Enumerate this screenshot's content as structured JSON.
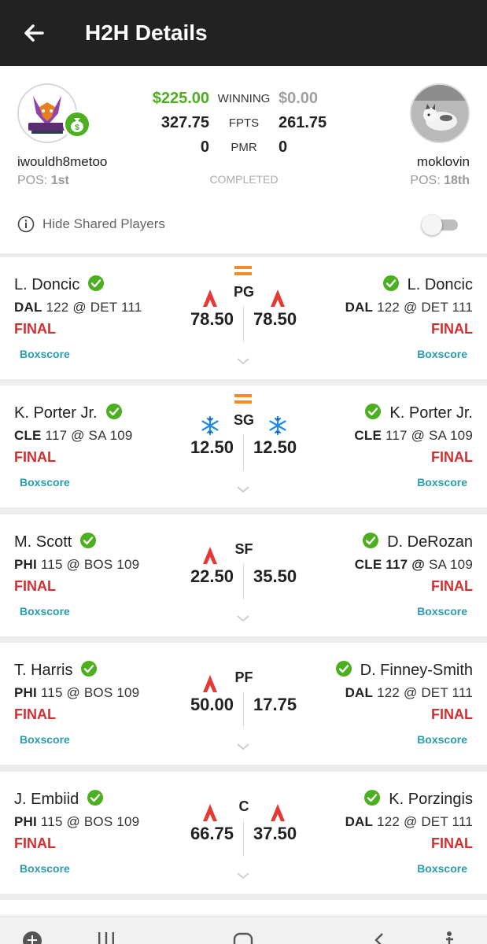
{
  "header": {
    "title": "H2H Details"
  },
  "summary": {
    "left_user": {
      "name": "iwouldh8metoo",
      "pos_label": "POS:",
      "pos_value": "1st"
    },
    "right_user": {
      "name": "moklovin",
      "pos_label": "POS:",
      "pos_value": "18th"
    },
    "winning": {
      "left": "$225.00",
      "label": "WINNING",
      "right": "$0.00"
    },
    "fpts": {
      "left": "327.75",
      "label": "FPTS",
      "right": "261.75"
    },
    "pmr": {
      "left": "0",
      "label": "PMR",
      "right": "0"
    },
    "status": "COMPLETED",
    "colors": {
      "win": "#4caf1f",
      "loss": "#a0a0a0"
    }
  },
  "hide_shared": {
    "label": "Hide Shared Players",
    "enabled": false
  },
  "matchups": [
    {
      "position": "PG",
      "shared": true,
      "left": {
        "name": "L. Doncic",
        "team": "DAL",
        "game": "122 @ DET 111",
        "status": "FINAL",
        "score": "78.50",
        "trend": "hot",
        "boxscore": "Boxscore"
      },
      "right": {
        "name": "L. Doncic",
        "team": "DAL",
        "game": "122 @ DET 111",
        "status": "FINAL",
        "score": "78.50",
        "trend": "hot",
        "boxscore": "Boxscore"
      }
    },
    {
      "position": "SG",
      "shared": true,
      "left": {
        "name": "K. Porter Jr.",
        "team": "CLE",
        "game": "117 @ SA 109",
        "status": "FINAL",
        "score": "12.50",
        "trend": "cold",
        "boxscore": "Boxscore"
      },
      "right": {
        "name": "K. Porter Jr.",
        "team": "CLE",
        "game": "117 @ SA 109",
        "status": "FINAL",
        "score": "12.50",
        "trend": "cold",
        "boxscore": "Boxscore"
      }
    },
    {
      "position": "SF",
      "shared": false,
      "left": {
        "name": "M. Scott",
        "team": "PHI",
        "game": "115 @ BOS 109",
        "status": "FINAL",
        "score": "22.50",
        "trend": "hot",
        "boxscore": "Boxscore"
      },
      "right": {
        "name": "D. DeRozan",
        "team": "CLE 117 @",
        "game": "SA 109",
        "status": "FINAL",
        "score": "35.50",
        "trend": "none",
        "boxscore": "Boxscore"
      }
    },
    {
      "position": "PF",
      "shared": false,
      "left": {
        "name": "T. Harris",
        "team": "PHI",
        "game": "115 @ BOS 109",
        "status": "FINAL",
        "score": "50.00",
        "trend": "hot",
        "boxscore": "Boxscore"
      },
      "right": {
        "name": "D. Finney-Smith",
        "team": "DAL",
        "game": "122 @ DET 111",
        "status": "FINAL",
        "score": "17.75",
        "trend": "none",
        "boxscore": "Boxscore"
      }
    },
    {
      "position": "C",
      "shared": false,
      "left": {
        "name": "J. Embiid",
        "team": "PHI",
        "game": "115 @ BOS 109",
        "status": "FINAL",
        "score": "66.75",
        "trend": "hot",
        "boxscore": "Boxscore"
      },
      "right": {
        "name": "K. Porzingis",
        "team": "DAL",
        "game": "122 @ DET 111",
        "status": "FINAL",
        "score": "37.50",
        "trend": "hot",
        "boxscore": "Boxscore"
      }
    }
  ],
  "icons": {
    "back": "arrow-left-icon",
    "money": "money-bag-icon",
    "info": "info-icon",
    "check": "check-circle-icon",
    "hot": "fire-icon",
    "cold": "snowflake-icon",
    "equal": "equal-icon",
    "expand": "chevron-down-icon"
  },
  "theme": {
    "final": "#d32f2f",
    "boxscore": "#2a9bb0",
    "check": "#4caf1f",
    "equal": "#f28c28",
    "hot": "#e53935",
    "cold": "#1e88e5"
  }
}
